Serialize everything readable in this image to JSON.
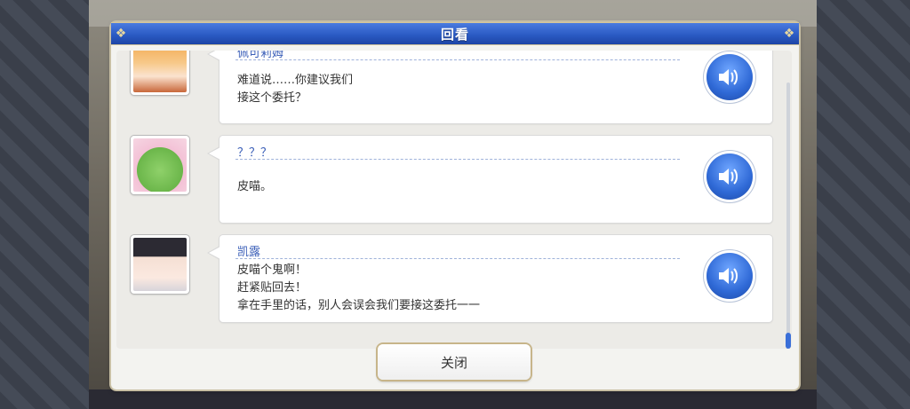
{
  "dialog": {
    "title": "回看",
    "close_label": "关闭"
  },
  "entries": [
    {
      "speaker": "佩可莉姆",
      "lines": [
        "难道说……你建议我们",
        "接这个委托？"
      ],
      "avatar_icon": "character-avatar-pecorine"
    },
    {
      "speaker": "？？？",
      "lines": [
        "皮喵。"
      ],
      "avatar_icon": "character-avatar-cat-mascot"
    },
    {
      "speaker": "凯露",
      "lines": [
        "皮喵个鬼啊！",
        "赶紧贴回去！",
        "拿在手里的话，别人会误会我们要接这委托一一"
      ],
      "avatar_icon": "character-avatar-karyl"
    }
  ],
  "icons": {
    "voice": "speaker-volume-icon"
  },
  "colors": {
    "accent": "#2b5bc4",
    "speaker_text": "#3b5fb8",
    "border_gold": "#c8bfa4"
  }
}
